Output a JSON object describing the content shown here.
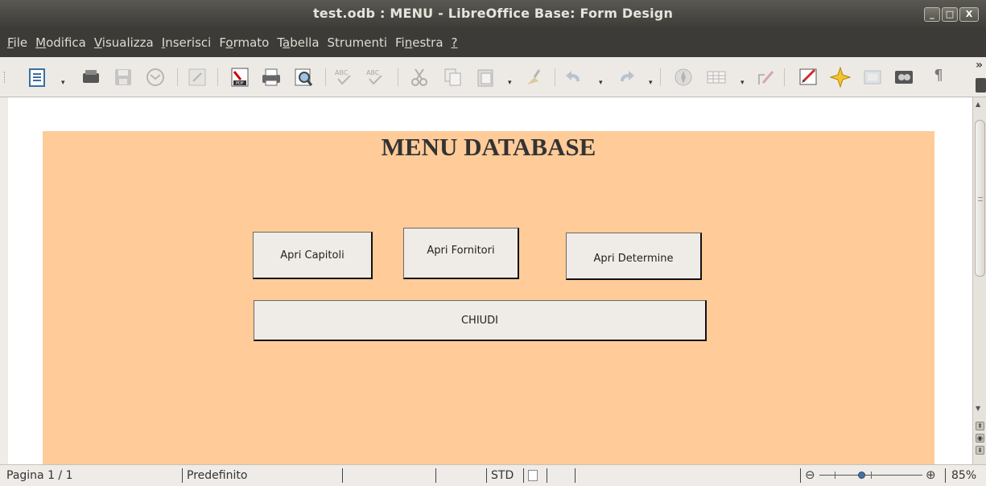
{
  "window": {
    "title": "test.odb : MENU - LibreOffice Base: Form Design",
    "controls": {
      "minimize": "_",
      "maximize": "□",
      "close": "X"
    }
  },
  "menubar": {
    "items": [
      "File",
      "Modifica",
      "Visualizza",
      "Inserisci",
      "Formato",
      "Tabella",
      "Strumenti",
      "Finestra",
      "?"
    ],
    "mnemonics": [
      "F",
      "M",
      "V",
      "I",
      "o",
      "a",
      "",
      "n",
      "?"
    ]
  },
  "toolbar": {
    "icons": [
      "new-document-icon",
      "dropdown-arrow-icon",
      "open-icon",
      "save-icon",
      "email-icon",
      "edit-file-icon",
      "export-pdf-icon",
      "print-icon",
      "print-preview-icon",
      "spellcheck-icon",
      "autospellcheck-icon",
      "cut-icon",
      "copy-icon",
      "paste-icon",
      "clone-formatting-icon",
      "undo-icon",
      "redo-icon",
      "navigator-icon",
      "table-icon",
      "show-draw-functions-icon",
      "form-design-icon",
      "gallery-icon",
      "data-sources-icon",
      "nonprinting-characters-icon"
    ],
    "overflow_label": "»"
  },
  "form": {
    "title": "MENU DATABASE",
    "buttons": {
      "capitoli": "Apri Capitoli",
      "fornitori": "Apri Fornitori",
      "determine": "Apri Determine",
      "chiudi": "CHIUDI"
    },
    "background_color": "#fecb99"
  },
  "statusbar": {
    "page": "Pagina 1 / 1",
    "page_style": "Predefinito",
    "selection_mode": "STD",
    "zoom": "85%",
    "zoom_minus": "⊖",
    "zoom_plus": "⊕"
  }
}
